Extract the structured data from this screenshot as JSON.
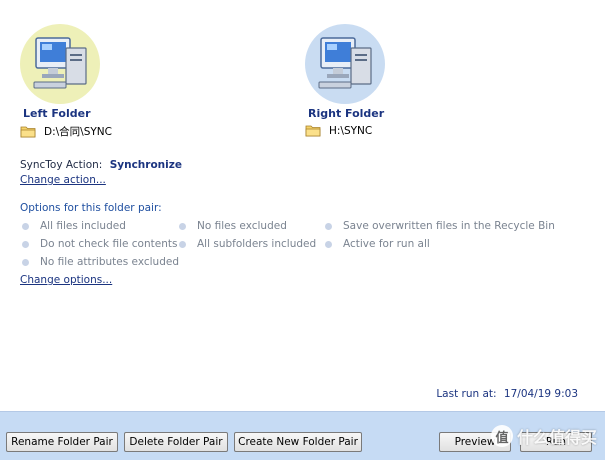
{
  "left_folder": {
    "title": "Left Folder",
    "path": "D:\\合同\\SYNC",
    "icon": "computer-icon",
    "bg_color": "#eef0b8"
  },
  "right_folder": {
    "title": "Right Folder",
    "path": "H:\\SYNC",
    "icon": "computer-icon",
    "bg_color": "#c9dcf2"
  },
  "action": {
    "label": "SyncToy Action:",
    "value": "Synchronize",
    "change_link": "Change action..."
  },
  "options": {
    "title": "Options for this folder pair:",
    "items": [
      "All files included",
      "No files excluded",
      "Save overwritten files in the Recycle Bin",
      "Do not check file contents",
      "All subfolders included",
      "Active for run all",
      "No file attributes excluded"
    ],
    "change_link": "Change options..."
  },
  "last_run": {
    "label": "Last run at:",
    "value": "17/04/19 9:03"
  },
  "buttons": {
    "rename": "Rename Folder Pair",
    "delete": "Delete Folder Pair",
    "create": "Create New Folder Pair",
    "preview": "Preview",
    "run": "Run"
  },
  "watermark": {
    "badge": "值",
    "text": "什么值得买"
  },
  "colors": {
    "accent": "#1b3480",
    "bottom_bar": "#c6dbf4",
    "option_text": "#7a8390"
  }
}
